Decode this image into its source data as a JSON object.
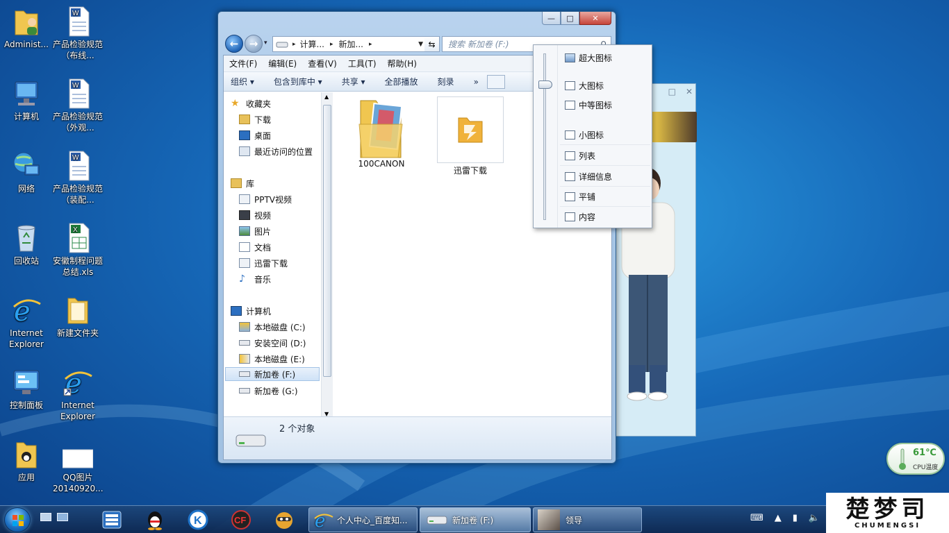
{
  "desktop": {
    "icons": [
      {
        "label": "Administ...",
        "icon": "user-folder-icon"
      },
      {
        "label": "产品检验规范（布线...",
        "icon": "word-document-icon"
      },
      {
        "label": "计算机",
        "icon": "computer-icon"
      },
      {
        "label": "产品检验规范（外观...",
        "icon": "word-document-icon"
      },
      {
        "label": "网络",
        "icon": "network-icon"
      },
      {
        "label": "产品检验规范（装配...",
        "icon": "word-document-icon"
      },
      {
        "label": "回收站",
        "icon": "recycle-bin-icon"
      },
      {
        "label": "安徽制程问题总结.xls",
        "icon": "excel-document-icon"
      },
      {
        "label": "Internet Explorer",
        "icon": "internet-explorer-icon"
      },
      {
        "label": "新建文件夹",
        "icon": "folder-icon"
      },
      {
        "label": "控制面板",
        "icon": "control-panel-icon"
      },
      {
        "label": "Internet Explorer",
        "icon": "internet-explorer-shortcut-icon"
      },
      {
        "label": "应用",
        "icon": "folder-icon"
      },
      {
        "label": "QQ图片20140920...",
        "icon": "image-file-icon"
      }
    ]
  },
  "explorer": {
    "window_controls": {
      "minimize": "—",
      "maximize": "□",
      "close": "✕"
    },
    "address": {
      "segments": [
        "计算...",
        "新加..."
      ],
      "separator": "▸"
    },
    "search": {
      "placeholder": "搜索 新加卷 (F:)"
    },
    "menu": [
      "文件(F)",
      "编辑(E)",
      "查看(V)",
      "工具(T)",
      "帮助(H)"
    ],
    "commands": [
      "组织 ▾",
      "包含到库中 ▾",
      "共享 ▾",
      "全部播放",
      "刻录",
      "»"
    ],
    "nav": {
      "favorites": {
        "title": "收藏夹",
        "items": [
          "下载",
          "桌面",
          "最近访问的位置"
        ]
      },
      "libraries": {
        "title": "库",
        "items": [
          "PPTV视频",
          "视频",
          "图片",
          "文档",
          "迅雷下载",
          "音乐"
        ]
      },
      "computer": {
        "title": "计算机",
        "items": [
          "本地磁盘 (C:)",
          "安装空间 (D:)",
          "本地磁盘 (E:)",
          "新加卷 (F:)",
          "新加卷 (G:)"
        ]
      }
    },
    "files": [
      {
        "name": "100CANON",
        "icon": "photo-folder-icon"
      },
      {
        "name": "迅雷下载",
        "icon": "folder-icon"
      }
    ],
    "status": {
      "count": "2 个对象"
    }
  },
  "view_menu": {
    "items": [
      "超大图标",
      "大图标",
      "中等图标",
      "小图标",
      "列表",
      "详细信息",
      "平铺",
      "内容"
    ],
    "selected_level": 0.17
  },
  "gadget": {
    "temperature": "61℃",
    "label": "CPU温度"
  },
  "taskbar": {
    "tasks": [
      {
        "label": "个人中心_百度知...",
        "icon": "internet-explorer-icon"
      },
      {
        "label": "新加卷 (F:)",
        "icon": "drive-icon"
      },
      {
        "label": "领导",
        "icon": "avatar-icon"
      }
    ]
  },
  "watermark": {
    "logo_text": "楚梦司",
    "subtitle": "CHUMENGSI"
  }
}
